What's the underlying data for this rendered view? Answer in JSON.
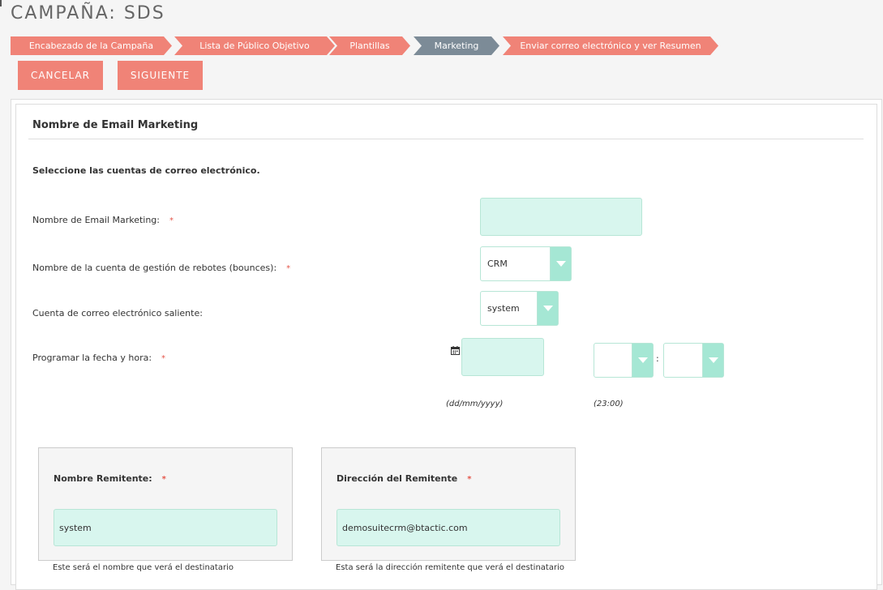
{
  "page": {
    "title": "CAMPAÑA: SDS"
  },
  "steps": [
    {
      "label": "Encabezado de la Campaña",
      "state": "done"
    },
    {
      "label": "Lista de Público Objetivo",
      "state": "done"
    },
    {
      "label": "Plantillas",
      "state": "done"
    },
    {
      "label": "Marketing",
      "state": "current"
    },
    {
      "label": "Enviar correo electrónico y ver Resumen",
      "state": "pending"
    }
  ],
  "actions": {
    "cancel": "CANCELAR",
    "next": "SIGUIENTE"
  },
  "form": {
    "section_title": "Nombre de Email Marketing",
    "subhead": "Seleccione las cuentas de correo electrónico.",
    "required_mark": "*",
    "email_marketing_name": {
      "label": "Nombre de Email Marketing:",
      "value": ""
    },
    "bounce_account": {
      "label": "Nombre de la cuenta de gestión de rebotes (bounces):",
      "value": "CRM"
    },
    "outgoing_account": {
      "label": "Cuenta de correo electrónico saliente:",
      "value": "system"
    },
    "schedule": {
      "label": "Programar la fecha y hora:",
      "date_value": "",
      "date_hint": "(dd/mm/yyyy)",
      "hour_value": "",
      "minute_value": "",
      "time_separator": ":",
      "time_hint": "(23:00)"
    },
    "sender_name": {
      "label": "Nombre Remitente:",
      "value": "system",
      "note": "Este será el nombre que verá el destinatario"
    },
    "sender_address": {
      "label": "Dirección del Remitente",
      "value": "demosuitecrm@btactic.com",
      "note": "Esta será la dirección remitente que verá el destinatario"
    }
  },
  "colors": {
    "accent": "#f08377",
    "current_step": "#7c8b97",
    "input_bg": "#d8f6ee",
    "select_arrow": "#a5e7d4",
    "required": "#e5574b"
  },
  "icons": {
    "calendar": "calendar-icon",
    "dropdown": "chevron-down-icon"
  }
}
